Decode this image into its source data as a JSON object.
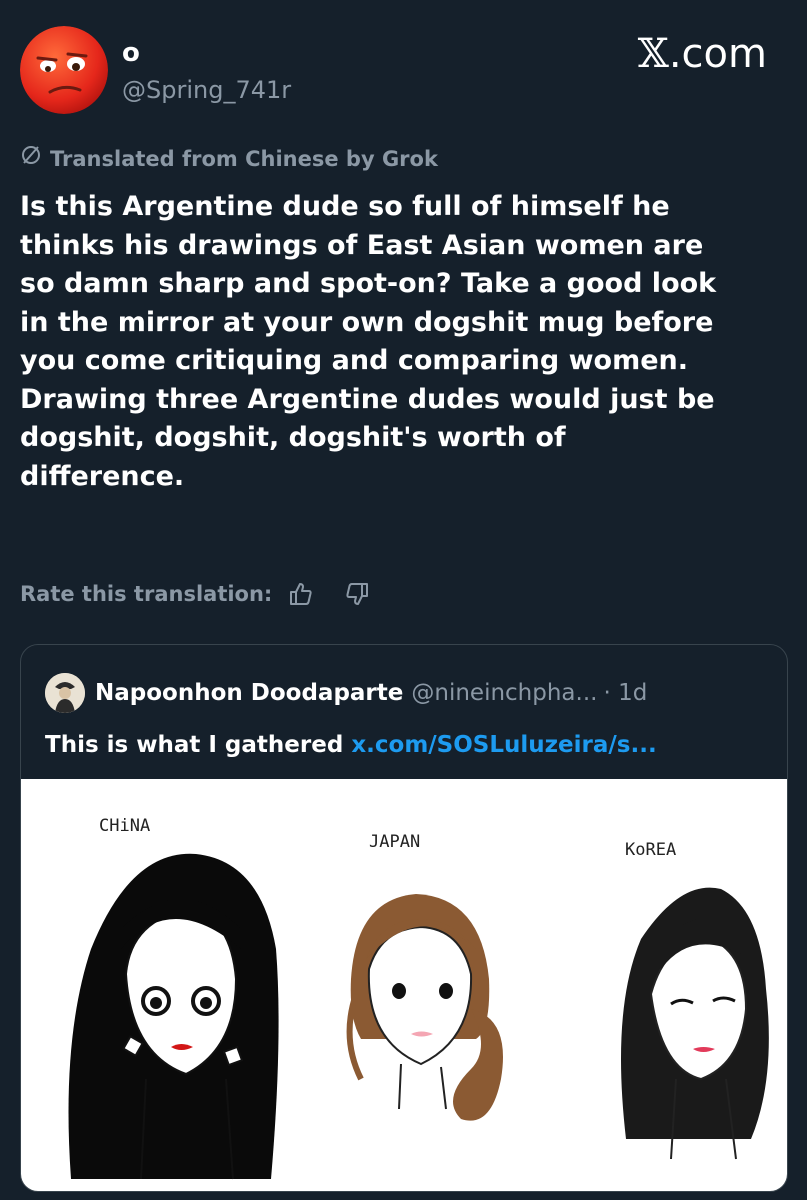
{
  "author": {
    "display_name": "o",
    "handle": "@Spring_741r"
  },
  "brand": {
    "label": ".com",
    "mark": "𝕏"
  },
  "translation": {
    "notice": "Translated from Chinese by Grok",
    "rate_label": "Rate this translation:"
  },
  "tweet": {
    "text": "Is this Argentine dude so full of himself he\nthinks his drawings of East Asian women are\nso damn sharp and spot-on? Take a good look\nin the mirror at your own dogshit mug before\nyou come critiquing and comparing women.\nDrawing three Argentine dudes would just be\ndogshit, dogshit, dogshit's worth of\ndifference."
  },
  "quote": {
    "name": "Napoonhon Doodaparte",
    "handle": "@nineinchpha...",
    "time": "· 1d",
    "text": "This is what I gathered",
    "link": "x.com/SOSLuluzeira/s...",
    "image_labels": [
      "CHiNA",
      "JAPAN",
      "KoREA"
    ]
  },
  "icons": {
    "translate": "translate-icon",
    "thumbs_up": "thumbs-up-icon",
    "thumbs_down": "thumbs-down-icon"
  },
  "colors": {
    "background": "#15202b",
    "secondary_text": "#8b98a5",
    "link": "#1d9bf0",
    "border": "#38444d"
  }
}
